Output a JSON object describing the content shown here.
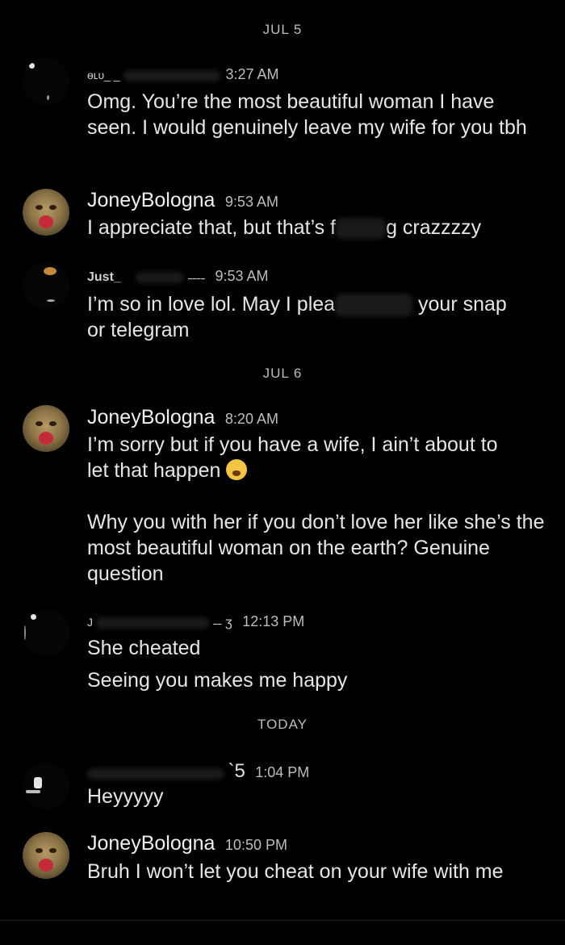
{
  "dividers": {
    "jul5": "JUL 5",
    "jul6": "JUL 6",
    "today": "TODAY"
  },
  "messages": [
    {
      "sender": "ɵʟᴜ_ _",
      "time": "3:27 AM",
      "text": "Omg. You’re the most beautiful woman I have seen. I would genuinely leave my wife for you tbh"
    },
    {
      "sender": "JoneyBologna",
      "time": "9:53 AM",
      "text_before": "I appreciate that, but that’s f",
      "text_after": "g crazzzzy"
    },
    {
      "sender": "Just_",
      "sender_tail": "˗˗˗˗",
      "time": "9:53 AM",
      "text_before": "I’m so in love lol. May I plea",
      "text_after": "your snap",
      "text_line2": "or telegram"
    },
    {
      "sender": "JoneyBologna",
      "time": "8:20 AM",
      "text_line1": "I’m sorry but if you have a wife, I ain’t about to",
      "text_line2": "let that happen",
      "emoji": "weary-face",
      "text_para2": "Why you with her if you don’t love her like she’s the most beautiful woman on the earth? Genuine question"
    },
    {
      "sender": "J",
      "sender_tail": "˗˗ ʒ",
      "time": "12:13 PM",
      "text_line1": "She cheated",
      "text_line2": "Seeing you makes me happy"
    },
    {
      "sender_tail": "`5",
      "time": "1:04 PM",
      "text": "Heyyyyy"
    },
    {
      "sender": "JoneyBologna",
      "time": "10:50 PM",
      "text": "Bruh I won’t let you cheat on your wife with me"
    }
  ]
}
